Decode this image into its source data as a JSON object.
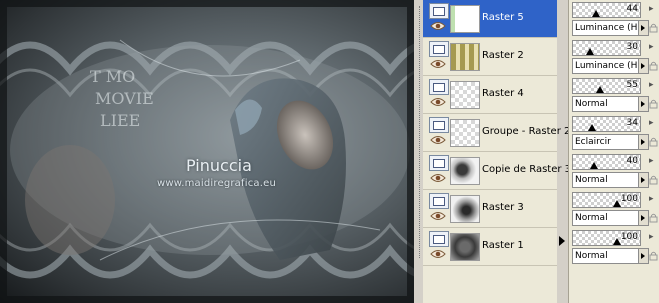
{
  "canvas": {
    "watermark_title": "Pinuccia",
    "watermark_url": "www.maidiregrafica.eu",
    "overlay_text": [
      "T MO",
      "MOVIE",
      "LIEE"
    ]
  },
  "layers": [
    {
      "name": "Raster 5",
      "selected": true,
      "thumb": "raster5"
    },
    {
      "name": "Raster 2",
      "selected": false,
      "thumb": "raster2"
    },
    {
      "name": "Raster 4",
      "selected": false,
      "thumb": "empty"
    },
    {
      "name": "Groupe - Raster 2",
      "selected": false,
      "thumb": "empty"
    },
    {
      "name": "Copie de Raster 3",
      "selected": false,
      "thumb": "copie3"
    },
    {
      "name": "Raster 3",
      "selected": false,
      "thumb": "raster3"
    },
    {
      "name": "Raster 1",
      "selected": false,
      "thumb": "raster1"
    }
  ],
  "properties": [
    {
      "opacity": "44",
      "blend": "Luminance (H)",
      "level": 0.44
    },
    {
      "opacity": "30",
      "blend": "Luminance (H)",
      "level": 0.3
    },
    {
      "opacity": "55",
      "blend": "Normal",
      "level": 0.55
    },
    {
      "opacity": "34",
      "blend": "Eclaircir",
      "level": 0.34
    },
    {
      "opacity": "40",
      "blend": "Normal",
      "level": 0.4
    },
    {
      "opacity": "100",
      "blend": "Normal",
      "level": 1.0
    },
    {
      "opacity": "100",
      "blend": "Normal",
      "level": 1.0
    }
  ],
  "colors": {
    "selection": "#2f63c8",
    "panel": "#ece9d8",
    "chrome": "#d4d0c8"
  }
}
